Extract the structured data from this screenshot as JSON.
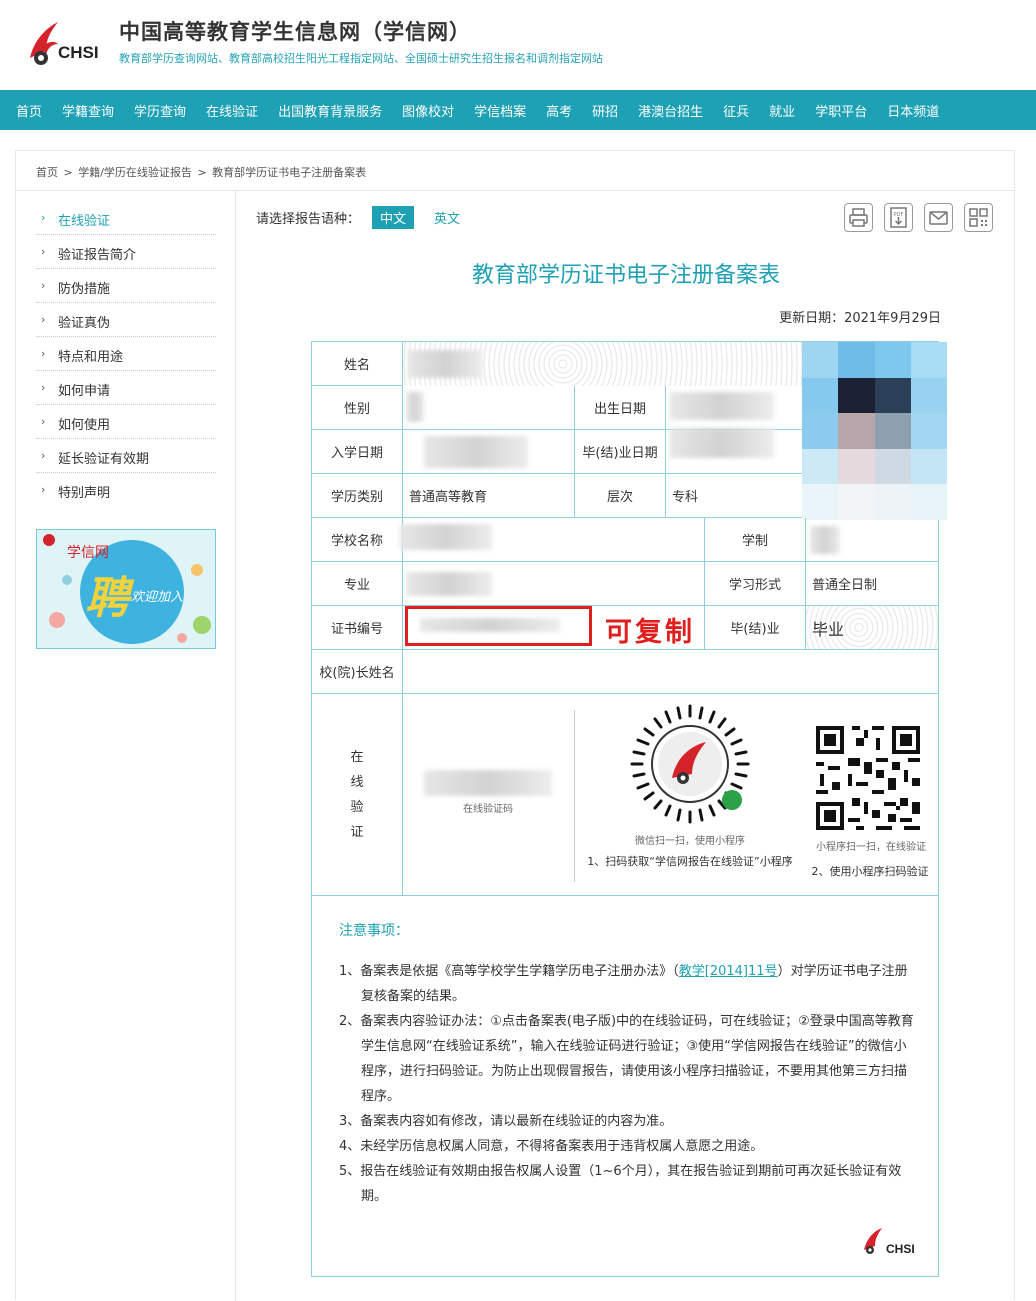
{
  "header": {
    "logo_text": "CHSI",
    "title": "中国高等教育学生信息网（学信网）",
    "subtitle": "教育部学历查询网站、教育部高校招生阳光工程指定网站、全国硕士研究生招生报名和调剂指定网站"
  },
  "nav": [
    "首页",
    "学籍查询",
    "学历查询",
    "在线验证",
    "出国教育背景服务",
    "图像校对",
    "学信档案",
    "高考",
    "研招",
    "港澳台招生",
    "征兵",
    "就业",
    "学职平台",
    "日本频道"
  ],
  "breadcrumb": [
    "首页",
    ">",
    "学籍/学历在线验证报告",
    ">",
    "教育部学历证书电子注册备案表"
  ],
  "sidebar": {
    "items": [
      "在线验证",
      "验证报告简介",
      "防伪措施",
      "验证真伪",
      "特点和用途",
      "如何申请",
      "如何使用",
      "延长验证有效期",
      "特别声明"
    ],
    "banner_brand": "学信网",
    "banner_big": "聘",
    "banner_small": "欢迎加入"
  },
  "report": {
    "lang_label": "请选择报告语种：",
    "lang_cn": "中文",
    "lang_en": "英文",
    "title": "教育部学历证书电子注册备案表",
    "update_date": "更新日期：2021年9月29日",
    "labels": {
      "name": "姓名",
      "gender": "性别",
      "birth": "出生日期",
      "enroll": "入学日期",
      "grad_date": "毕(结)业日期",
      "edu_type": "学历类别",
      "level": "层次",
      "school": "学校名称",
      "duration": "学制",
      "major": "专业",
      "study_form": "学习形式",
      "cert_no": "证书编号",
      "grad": "毕(结)业",
      "principal": "校(院)长姓名",
      "online_verify": [
        "在",
        "线",
        "验",
        "证"
      ]
    },
    "values": {
      "edu_type": "普通高等教育",
      "level": "专科",
      "study_form": "普通全日制",
      "grad": "毕业"
    },
    "copy_note": "可复制",
    "verify_code_caption": "在线验证码",
    "wechat_caption": "微信扫一扫，使用小程序",
    "step1": "1、扫码获取“学信网报告在线验证”小程序",
    "mini_caption": "小程序扫一扫，在线验证",
    "step2": "2、使用小程序扫码验证",
    "notes_title": "注意事项：",
    "notes": [
      {
        "pre": "1、备案表是依据《高等学校学生学籍学历电子注册办法》（",
        "link": "教学[2014]11号",
        "post": "）对学历证书电子注册复核备案的结果。"
      },
      {
        "pre": "2、备案表内容验证办法：①点击备案表(电子版)中的在线验证码，可在线验证；②登录中国高等教育学生信息网“在线验证系统”，输入在线验证码进行验证；③使用“学信网报告在线验证”的微信小程序，进行扫码验证。为防止出现假冒报告，请使用该小程序扫描验证，不要用其他第三方扫描程序。",
        "link": "",
        "post": ""
      },
      {
        "pre": "3、备案表内容如有修改，请以最新在线验证的内容为准。",
        "link": "",
        "post": ""
      },
      {
        "pre": "4、未经学历信息权属人同意，不得将备案表用于违背权属人意愿之用途。",
        "link": "",
        "post": ""
      },
      {
        "pre": "5、报告在线验证有效期由报告权属人设置（1~6个月），其在报告验证到期前可再次延长验证有效期。",
        "link": "",
        "post": ""
      }
    ],
    "footer_logo": "CHSI"
  },
  "colors": {
    "accent": "#1ea1b5",
    "red": "#e01e1e"
  },
  "icons": [
    "print-icon",
    "pdf-download-icon",
    "mail-icon",
    "qrcode-icon"
  ]
}
